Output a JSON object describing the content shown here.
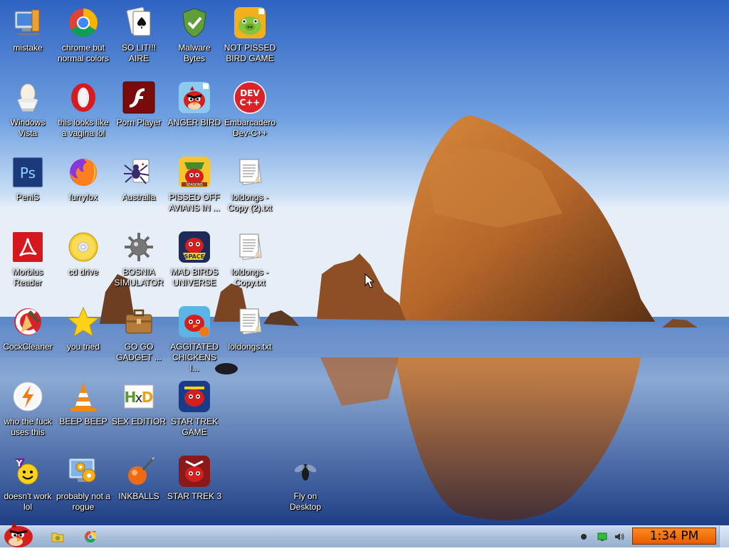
{
  "desktop": {
    "icons": [
      {
        "label": "mistake",
        "icon": "monitor-tools-icon"
      },
      {
        "label": "chrome but normal colors",
        "icon": "chrome-icon"
      },
      {
        "label": "SO LIT!!! AIRE",
        "icon": "playing-card-icon"
      },
      {
        "label": "Malware Bytes",
        "icon": "shield-icon"
      },
      {
        "label": "NOT PISSED BIRD GAME",
        "icon": "green-pig-icon"
      },
      {
        "label": "Windows Vista",
        "icon": "egg-in-cup-icon"
      },
      {
        "label": "this looks like a vagina lol",
        "icon": "opera-icon"
      },
      {
        "label": "Porn Player",
        "icon": "flash-icon"
      },
      {
        "label": "ANGER BIRD",
        "icon": "angry-bird-icon"
      },
      {
        "label": "Embarcadero Dev-C++",
        "icon": "dev-cpp-icon"
      },
      {
        "label": "PeniS",
        "icon": "photoshop-icon"
      },
      {
        "label": "furryfox",
        "icon": "firefox-icon"
      },
      {
        "label": "Australia",
        "icon": "spider-solitaire-icon"
      },
      {
        "label": "PISSED OFF AVIANS IN ...",
        "icon": "angry-birds-seasons-icon"
      },
      {
        "label": "loldongs - Copy (2).txt",
        "icon": "text-file-icon"
      },
      {
        "label": "Morbius Reader",
        "icon": "pdf-reader-icon"
      },
      {
        "label": "cd drive",
        "icon": "cd-icon"
      },
      {
        "label": "BOSNIA SIMULATOR",
        "icon": "mine-icon"
      },
      {
        "label": "MAD BIRDS UNIVERSE",
        "icon": "angry-birds-space-icon"
      },
      {
        "label": "loldongs - Copy.txt",
        "icon": "text-file-icon"
      },
      {
        "label": "CockCleaner",
        "icon": "ccleaner-icon"
      },
      {
        "label": "you tried",
        "icon": "star-icon"
      },
      {
        "label": "GO GO GADGET ...",
        "icon": "briefcase-icon"
      },
      {
        "label": "AGGITATED CHICKENS I...",
        "icon": "angry-birds-rio-icon"
      },
      {
        "label": "loldongs.txt",
        "icon": "text-file-icon"
      },
      {
        "label": "who the fuck uses this",
        "icon": "winamp-icon"
      },
      {
        "label": "BEEP BEEP",
        "icon": "vlc-cone-icon"
      },
      {
        "label": "SEX EDITIOR",
        "icon": "hxd-editor-icon"
      },
      {
        "label": "STAR TREK GAME",
        "icon": "angry-birds-star-wars-icon"
      },
      {
        "label": "doesn't work lol",
        "icon": "yahoo-messenger-icon"
      },
      {
        "label": "probably not a rogue",
        "icon": "settings-monitor-icon"
      },
      {
        "label": "INKBALLS",
        "icon": "inkball-icon"
      },
      {
        "label": "STAR TREK 3",
        "icon": "angry-birds-star-wars-2-icon"
      },
      {
        "label": "Fly on Desktop",
        "icon": "fly-icon"
      }
    ]
  },
  "taskbar": {
    "start_icon": "angry-bird-start-icon",
    "pinned": [
      {
        "icon": "folder-icon",
        "name": "explorer"
      },
      {
        "icon": "chrome-icon",
        "name": "chrome"
      }
    ],
    "tray": [
      {
        "icon": "record-dot-icon"
      },
      {
        "icon": "network-monitor-icon"
      },
      {
        "icon": "speaker-icon"
      }
    ],
    "clock": "1:34 PM"
  },
  "colors": {
    "taskbar": "#a9bfd9",
    "clock_bg": "#ff7a10",
    "sky_top": "#3e6fc8",
    "rock": "#b5662a"
  }
}
